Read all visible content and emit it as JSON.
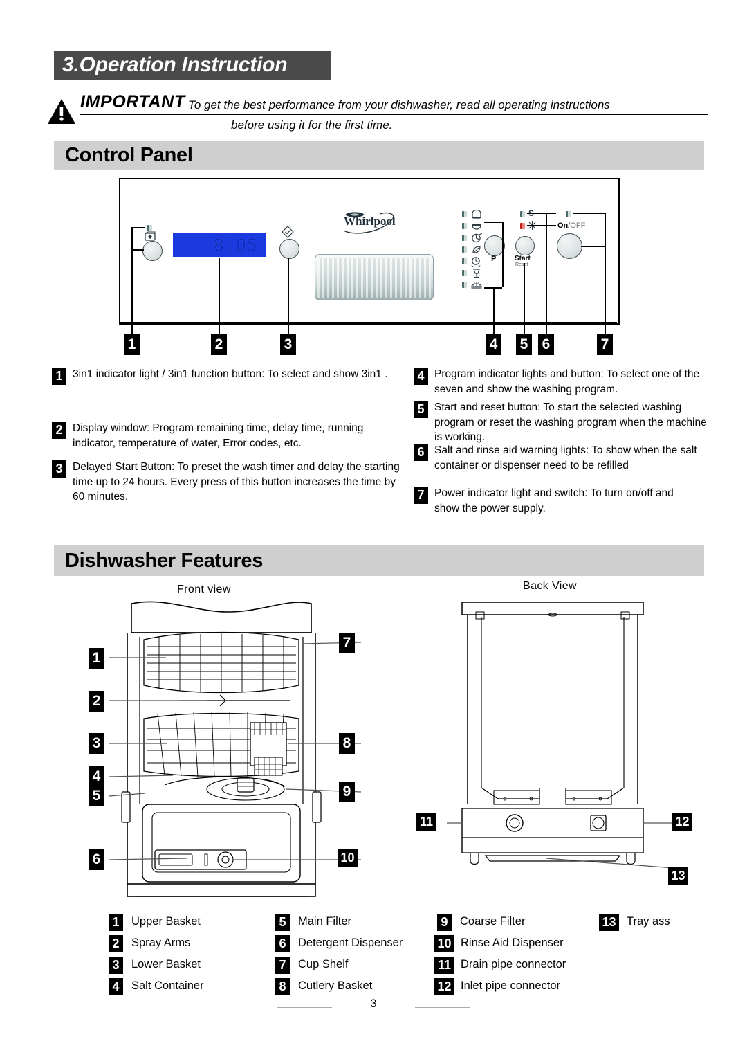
{
  "chapter": {
    "title": "3.Operation Instruction"
  },
  "important": {
    "label": "IMPORTANT",
    "line1": "To get the best performance from your dishwasher, read all operating instructions",
    "line2": "before using it for the first time."
  },
  "sections": {
    "control_panel": "Control Panel",
    "dishwasher_features": "Dishwasher Features"
  },
  "control_panel": {
    "brand": "Whirlpool",
    "display_value": "8:05",
    "program_button_label": "P",
    "start_button_label": "Start",
    "start_button_sublabel": "Reset",
    "power_label_on": "On",
    "power_label_sep": "/",
    "power_label_off": "OFF",
    "salt_indicator_label": "S",
    "callout_numbers": [
      "1",
      "2",
      "3",
      "4",
      "5",
      "6",
      "7"
    ],
    "program_icons": [
      "pot-intensive-icon",
      "plate-normal-icon",
      "clock-quick-icon",
      "eco-leaf-icon",
      "timer-soak-icon",
      "glass-delicate-icon",
      "rinse-icon"
    ],
    "indicator_icons": [
      "salt-s-icon",
      "rinse-aid-starburst-icon",
      "power-led-icon"
    ],
    "threein1_icon": "3in1-tablet-icon",
    "delay_icon": "delay-diamond-icon",
    "colors": {
      "display_blue": "#1a3ae0",
      "led_teal": "#4e6b6b",
      "led_red": "#c01e12"
    }
  },
  "descriptions_left": [
    {
      "num": "1",
      "text": "3in1 indicator light / 3in1 function button: To select and show 3in1 ."
    },
    {
      "num": "2",
      "text": "Display window: Program remaining time, delay time, running indicator, temperature of water,  Error codes, etc."
    },
    {
      "num": "3",
      "text": "Delayed Start Button: To preset the wash timer and delay the starting time up to 24 hours. Every  press of  this button increases the time by 60 minutes."
    }
  ],
  "descriptions_right": [
    {
      "num": "4",
      "text": "Program indicator lights and button: To select one of  the seven and show the washing program."
    },
    {
      "num": "5",
      "text": "Start and reset button: To start the selected washing program or reset the washing program when the machine is working."
    },
    {
      "num": "6",
      "text": "Salt and rinse aid warning lights: To show when the salt container or dispenser need to be refilled"
    },
    {
      "num": "7",
      "text": "Power indicator light and switch: To turn on/off and show the power supply."
    }
  ],
  "features": {
    "front_view_label": "Front  view",
    "back_view_label": "Back   View",
    "front_left_callouts": [
      "1",
      "2",
      "3",
      "4",
      "5",
      "6"
    ],
    "front_right_callouts": [
      "7",
      "8",
      "9",
      "10"
    ],
    "back_callouts": [
      "11",
      "12",
      "13"
    ]
  },
  "legend": {
    "col1": [
      {
        "num": "1",
        "label": "Upper Basket"
      },
      {
        "num": "2",
        "label": "Spray Arms"
      },
      {
        "num": "3",
        "label": "Lower Basket"
      },
      {
        "num": "4",
        "label": "Salt Container"
      }
    ],
    "col2": [
      {
        "num": "5",
        "label": "Main Filter"
      },
      {
        "num": "6",
        "label": "Detergent Dispenser"
      },
      {
        "num": "7",
        "label": "Cup Shelf"
      },
      {
        "num": "8",
        "label": "Cutlery Basket"
      }
    ],
    "col3": [
      {
        "num": "9",
        "label": "Coarse Filter"
      },
      {
        "num": "10",
        "label": "Rinse Aid Dispenser"
      },
      {
        "num": "11",
        "label": "Drain pipe connector"
      },
      {
        "num": "12",
        "label": "Inlet pipe connector"
      }
    ],
    "col4": [
      {
        "num": "13",
        "label": "Tray ass"
      }
    ]
  },
  "page_number": "3"
}
